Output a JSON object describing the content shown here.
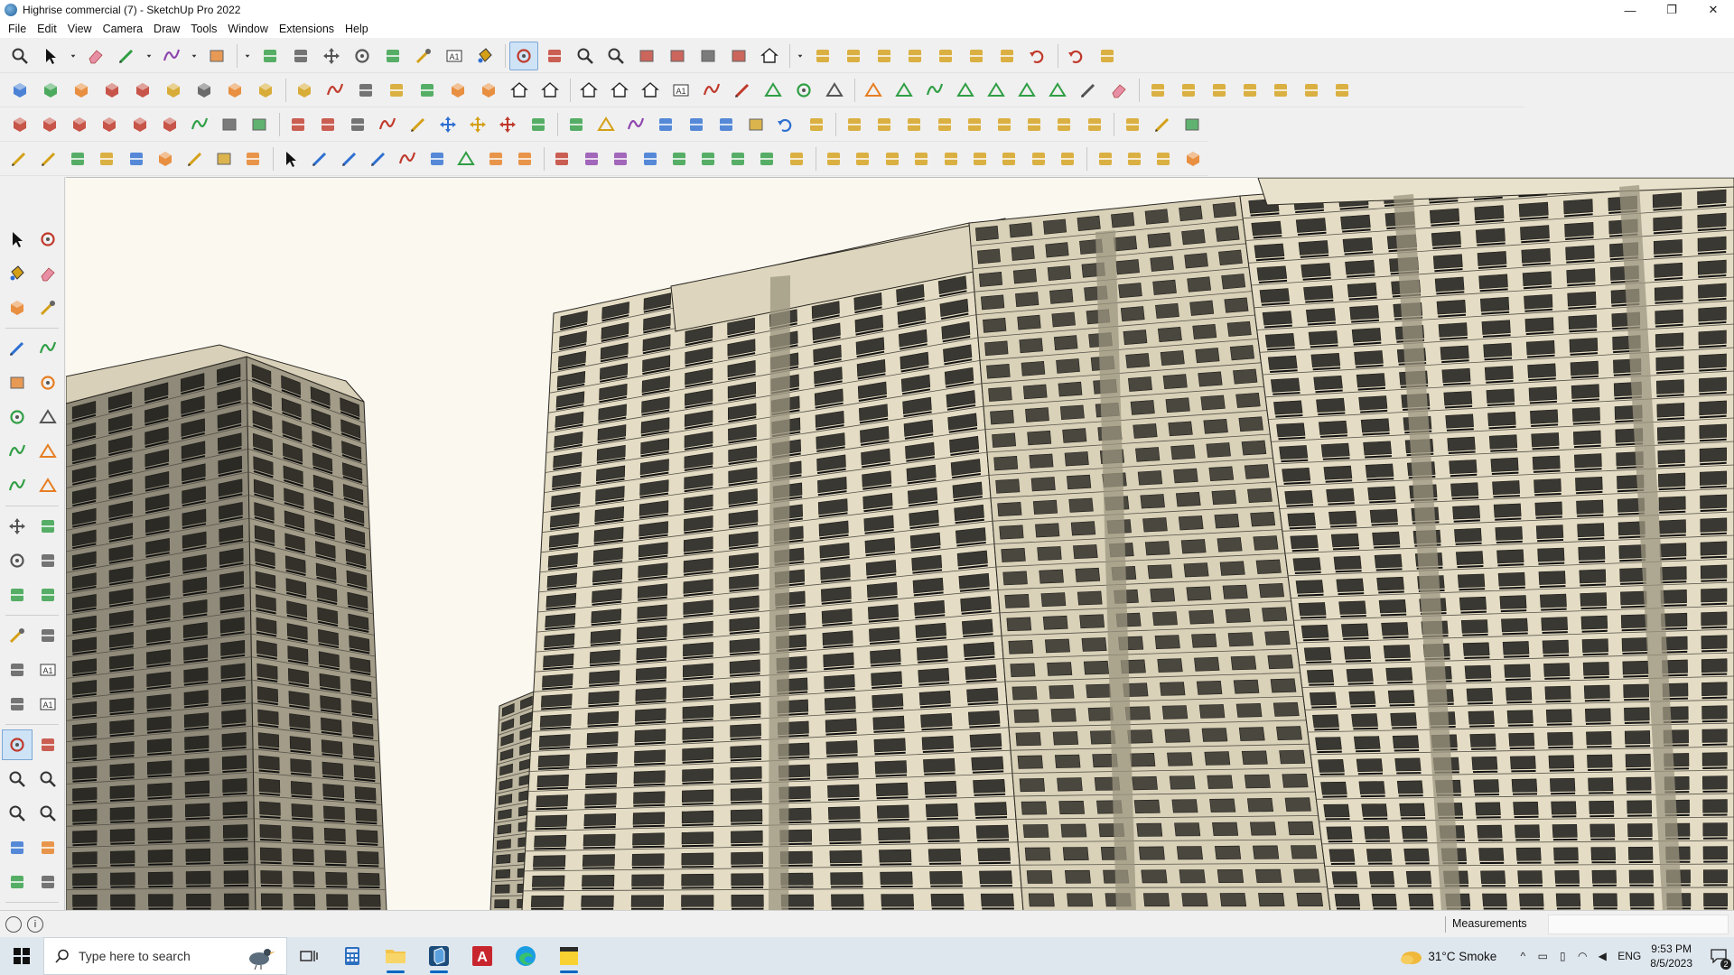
{
  "window": {
    "title": "Highrise commercial (7) - SketchUp Pro 2022",
    "controls": {
      "minimize": "—",
      "maximize": "❐",
      "close": "✕"
    }
  },
  "menu": [
    "File",
    "Edit",
    "View",
    "Camera",
    "Draw",
    "Tools",
    "Window",
    "Extensions",
    "Help"
  ],
  "toolbar_rows": [
    [
      "zoom-icon",
      "select-icon",
      "dropdown-icon",
      "eraser-icon",
      "pencil-icon",
      "dropdown-icon",
      "lasso-icon",
      "dropdown-icon",
      "rectangle-icon",
      "dropdown-icon",
      "pushpull-icon",
      "followme-icon",
      "move-icon",
      "rotate-icon",
      "scale-icon",
      "tape-measure-icon",
      "text-icon",
      "paint-bucket-icon",
      "orbit-icon",
      "pan-icon",
      "zoom-icon",
      "zoom-extents-icon",
      "sandbox-icon",
      "sandbox-smoove-icon",
      "sandbox-stamp-icon",
      "sandbox-drape-icon",
      "warehouse-icon",
      "dropdown-icon",
      "extension-icon",
      "extension-icon",
      "extension-icon",
      "extension-icon",
      "extension-icon",
      "extension-icon",
      "extension-icon",
      "undo-icon",
      "redo-icon",
      "extension-icon"
    ],
    [
      "isometric-view-icon",
      "top-view-icon",
      "front-view-icon",
      "solid-union-icon",
      "solid-subtract-icon",
      "solid-trim-icon",
      "solid-split-icon",
      "solid-outer-icon",
      "solid-intersect-icon",
      "solid-combine-icon",
      "curve-icon",
      "section-plane-icon",
      "section-display-icon",
      "section-cut-icon",
      "component-icon",
      "component-icon",
      "building-icon",
      "house-icon",
      "roof-icon",
      "house-icon",
      "building-icon",
      "font-icon",
      "curve-icon",
      "pencil-red-icon",
      "shape-icon",
      "circle-icon",
      "polygon-icon",
      "ellipse-icon",
      "parallelogram-icon",
      "arc-icon",
      "shape-icon",
      "shape-icon",
      "shape-icon",
      "shape-icon",
      "line-red-icon",
      "eraser-pink-icon",
      "extension-icon",
      "extension-icon",
      "extension-icon",
      "extension-icon",
      "extension-icon",
      "extension-icon",
      "extension-icon"
    ],
    [
      "extrude-icon",
      "extrude-icon",
      "extrude-icon",
      "extrude-icon",
      "extrude-icon",
      "extrude-icon",
      "arc-icon",
      "rectangle-red-icon",
      "grid-icon",
      "frame-icon",
      "beam-icon",
      "link-icon",
      "curve-icon",
      "spline-icon",
      "move-red-icon",
      "move-green-icon",
      "move-blue-icon",
      "scale-icon",
      "scale-icon",
      "warning-icon",
      "lasso-icon",
      "node-icon",
      "node-icon",
      "node-icon",
      "box-icon",
      "undo-red-icon",
      "extension-icon",
      "extension-icon",
      "extension-icon",
      "extension-icon",
      "extension-icon",
      "extension-icon",
      "extension-icon",
      "extension-icon",
      "extension-icon",
      "extension-icon",
      "extension-icon",
      "spline-icon",
      "grid-icon"
    ],
    [
      "spline-icon",
      "spline-icon",
      "car-icon",
      "cut-icon",
      "gear-icon",
      "component-icon",
      "spline-icon",
      "box-icon",
      "sphere-icon",
      "arrow-icon",
      "line-icon",
      "line-icon",
      "line-icon",
      "curve-icon",
      "stair-icon",
      "shape-icon",
      "rail-icon",
      "rail-icon",
      "hand-icon",
      "leaf-icon",
      "leaf-icon",
      "stair-icon",
      "brush-icon",
      "brush-icon",
      "brush-icon",
      "brush-icon",
      "extension-icon",
      "extension-icon",
      "extension-icon",
      "extension-icon",
      "extension-icon",
      "extension-icon",
      "extension-icon",
      "extension-icon",
      "extension-icon",
      "extension-icon",
      "extension-icon",
      "extension-icon",
      "extension-icon",
      "cube-icon"
    ]
  ],
  "palette": [
    [
      "select-icon",
      "orbit-icon"
    ],
    [
      "paint-bucket-icon",
      "eraser-icon"
    ],
    [
      "component-icon",
      "tape-measure-icon"
    ],
    [
      "line-icon",
      "freehand-icon"
    ],
    [
      "rectangle-icon",
      "rotated-rectangle-icon"
    ],
    [
      "circle-icon",
      "polygon-icon"
    ],
    [
      "arc-icon",
      "pie-icon"
    ],
    [
      "arc-icon",
      "pie-icon"
    ],
    [
      "move-icon",
      "pushpull-icon"
    ],
    [
      "rotate-icon",
      "followme-icon"
    ],
    [
      "scale-icon",
      "offset-icon"
    ],
    [
      "tape-measure-icon",
      "dimension-icon"
    ],
    [
      "protractor-icon",
      "text-icon"
    ],
    [
      "axes-icon",
      "3d-text-icon"
    ],
    [
      "orbit-icon",
      "pan-icon"
    ],
    [
      "zoom-icon",
      "zoom-window-icon"
    ],
    [
      "zoom-extents-icon",
      "zoom-previous-icon"
    ],
    [
      "position-camera-icon",
      "look-around-icon"
    ],
    [
      "walk-icon",
      "section-plane-icon"
    ],
    [
      "sandbox-icon",
      "sandbox-smoove-icon"
    ],
    [
      "sandbox-stamp-icon",
      "sandbox-drape-icon"
    ]
  ],
  "statusbar": {
    "info_icon": "i",
    "measurements_label": "Measurements",
    "measurements_value": ""
  },
  "taskbar": {
    "search_placeholder": "Type here to search",
    "weather": "31°C  Smoke",
    "language": "ENG",
    "time": "9:53 PM",
    "date": "8/5/2023",
    "notification_count": "2"
  },
  "colors": {
    "sky": "#fbf8f0",
    "facade": "#e4dcc4",
    "facade_shadow": "#9c9580",
    "window_dark": "#3a3832",
    "accent_blue": "#0067c0",
    "active_tool": "#cfe3f7"
  }
}
